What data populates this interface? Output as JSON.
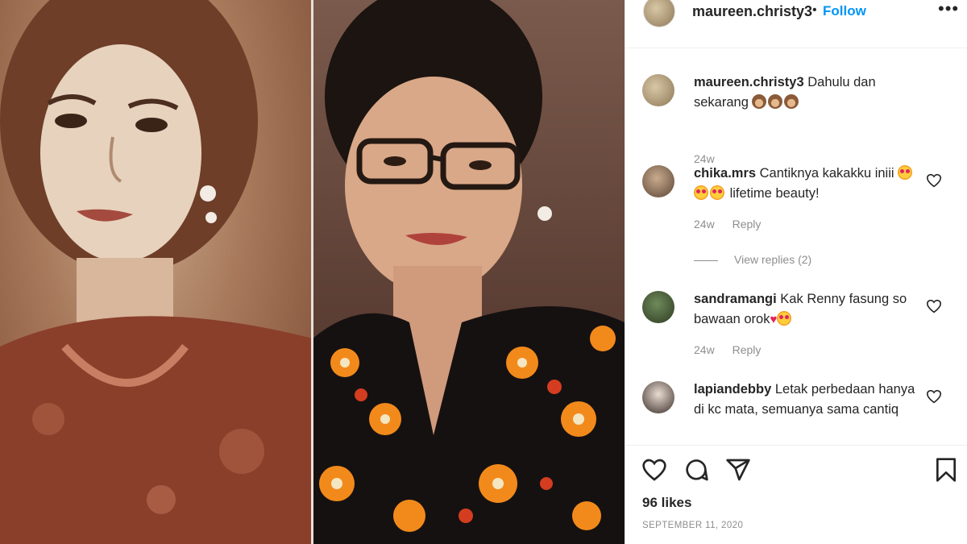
{
  "post": {
    "username": "maureen.christy3",
    "separator": "•",
    "follow_label": "Follow",
    "more_label": "•••"
  },
  "comments": [
    {
      "username": "maureen.christy3",
      "text": "Dahulu dan sekarang",
      "emojis": [
        "see-no-evil-monkey",
        "see-no-evil-monkey",
        "see-no-evil-monkey"
      ],
      "time": "24w"
    },
    {
      "username": "chika.mrs",
      "text_before": "Cantiknya kakakku iniii",
      "emojis": [
        "star-struck",
        "star-struck",
        "star-struck"
      ],
      "text_after": "lifetime beauty!",
      "time": "24w",
      "reply_label": "Reply",
      "view_replies": "View replies (2)"
    },
    {
      "username": "sandramangi",
      "text_before": "Kak Renny fasung so bawaan orok",
      "emojis": [
        "heart",
        "star-struck"
      ],
      "time": "24w",
      "reply_label": "Reply"
    },
    {
      "username": "lapiandebby",
      "text": "Letak perbedaan hanya di kc mata, semuanya sama cantiq"
    }
  ],
  "actions": {
    "icons": [
      "heart-icon",
      "comment-icon",
      "share-icon",
      "bookmark-icon"
    ],
    "likes": "96 likes",
    "date": "SEPTEMBER 11, 2020"
  },
  "colors": {
    "follow": "#0095f6",
    "meta_text": "#8e8e8e",
    "primary_text": "#262626"
  }
}
